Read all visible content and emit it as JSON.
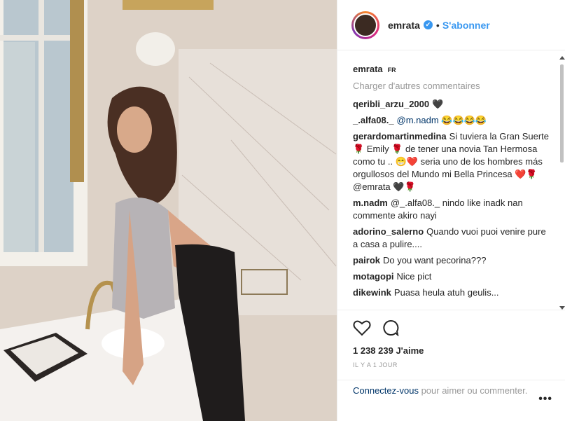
{
  "post": {
    "username": "emrata",
    "follow_label": "S'abonner",
    "separator": "•",
    "verified_glyph": "✔"
  },
  "caption": {
    "username": "emrata",
    "lang": "FR"
  },
  "load_more": "Charger d'autres commentaires",
  "comments": [
    {
      "user": "qeribli_arzu_2000",
      "text": "🖤"
    },
    {
      "user": "_.alfa08._",
      "text": "@m.nadm 😂😂😂😂"
    },
    {
      "user": "gerardomartinmedina",
      "text": "Si tuviera la Gran Suerte 🌹 Emily 🌹 de tener una novia Tan Hermosa como tu .. 😁❤️ seria uno de los hombres más orgullosos del Mundo mi Bella Princesa ❤️🌹 @emrata 🖤🌹"
    },
    {
      "user": "m.nadm",
      "text": "@_.alfa08._ nindo like inadk nan commente akiro nayi"
    },
    {
      "user": "adorino_salerno",
      "text": "Quando vuoi puoi venire pure a casa a pulire...."
    },
    {
      "user": "pairok",
      "text": "Do you want pecorina???"
    },
    {
      "user": "motagopi",
      "text": "Nice pict"
    },
    {
      "user": "dikewink",
      "text": "Puasa heula atuh geulis..."
    }
  ],
  "likes": "1 238 239 J'aime",
  "timestamp": "IL Y A 1 JOUR",
  "login": {
    "link": "Connectez-vous",
    "rest": " pour aimer ou commenter."
  },
  "more_label": "•••",
  "icons": {
    "like": "heart-icon",
    "comment": "comment-icon",
    "more": "more-options-icon"
  },
  "colors": {
    "accent": "#3897f0",
    "border": "#efefef",
    "muted": "#999999"
  }
}
